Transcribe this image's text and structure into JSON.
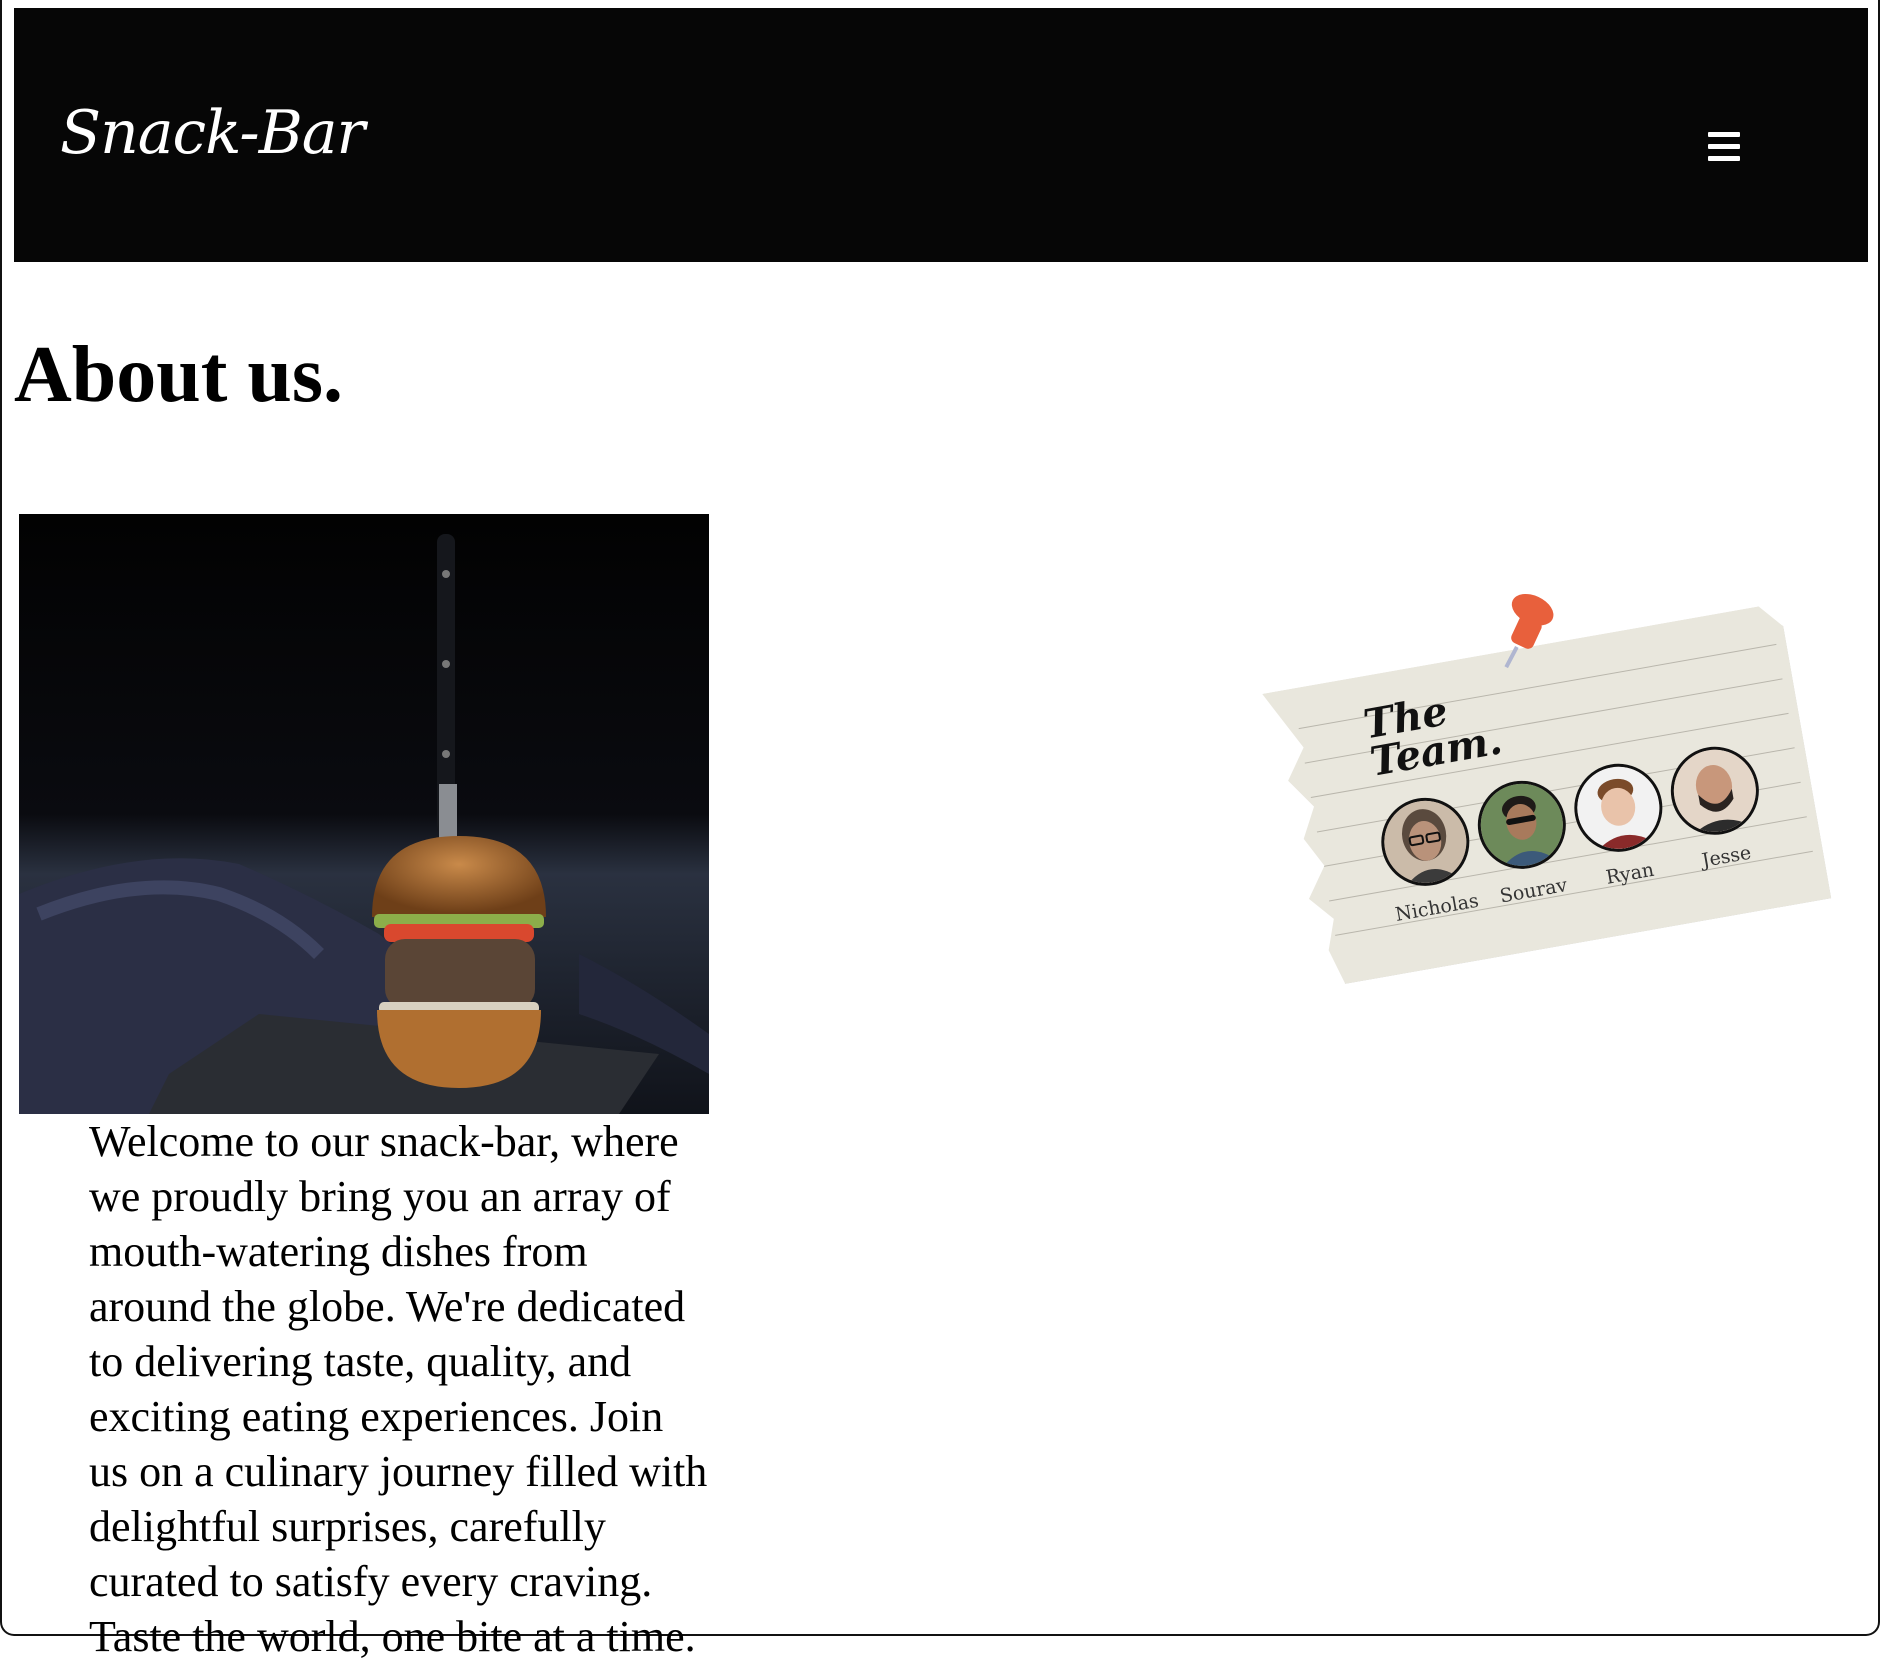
{
  "header": {
    "brand": "Snack-Bar",
    "menu_icon": "hamburger-menu-icon"
  },
  "page": {
    "title": "About us.",
    "intro": "Welcome to our snack-bar, where we proudly bring you an array of mouth-watering dishes from around the globe. We're dedicated to delivering taste, quality, and exciting eating experiences. Join us on a culinary journey filled with delightful surprises, carefully curated to satisfy every craving. Taste the world, one bite at a time."
  },
  "team": {
    "title_line1": "The",
    "title_line2": "Team.",
    "members": [
      {
        "name": "Nicholas",
        "skin": "#b9927a",
        "hair": "#5a4a3e"
      },
      {
        "name": "Sourav",
        "skin": "#a87a5c",
        "hair": "#1e1a18"
      },
      {
        "name": "Ryan",
        "skin": "#e9c3aa",
        "hair": "#7b4b2a"
      },
      {
        "name": "Jesse",
        "skin": "#c8977b",
        "hair": "#2a2320"
      }
    ]
  },
  "colors": {
    "header_bg": "#060606",
    "pin": "#e8603c",
    "paper": "#e9e7dd"
  }
}
